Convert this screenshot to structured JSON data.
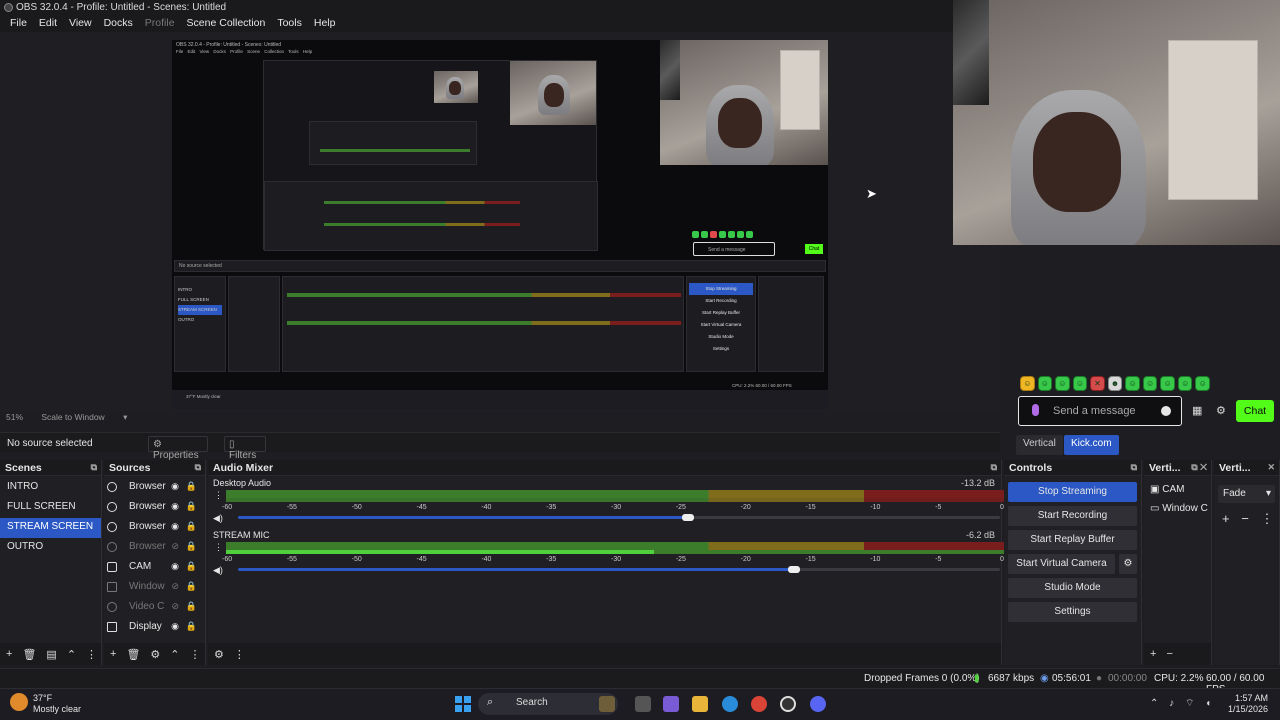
{
  "window": {
    "title": "OBS 32.0.4 - Profile: Untitled - Scenes: Untitled"
  },
  "menu": [
    "File",
    "Edit",
    "View",
    "Docks",
    "Profile",
    "Scene Collection",
    "Tools",
    "Help"
  ],
  "preview": {
    "nested_title": "OBS 32.0.4 - Profile: Untitled - Scenes: Untitled",
    "nested_menu": "File Edit View Docks Profile Scene Collection Tools Help",
    "nested_status": "No source selected",
    "nested_controls": [
      "Stop Streaming",
      "Start Recording",
      "Start Replay Buffer",
      "Start Virtual Camera",
      "Studio Mode",
      "Settings"
    ],
    "nested_scenes": [
      "INTRO",
      "FULL SCREEN",
      "STREAM SCREEN",
      "OUTRO"
    ],
    "nested_cpu": "CPU: 2.2%   60.00 / 60.00 FPS",
    "nested_weather": "37°F Mostly clear"
  },
  "chat": {
    "placeholder": "Send a message",
    "send_label": "Chat",
    "emotes": [
      "☺",
      "☺",
      "☺",
      "☺",
      "✕",
      "☻",
      "☺",
      "☺",
      "☺",
      "☺",
      "☺"
    ]
  },
  "zoom": {
    "level": "51%",
    "mode": "Scale to Window"
  },
  "selection": {
    "status": "No source selected",
    "properties": "Properties",
    "filters": "Filters"
  },
  "tabs": {
    "vertical": "Vertical",
    "kick": "Kick.com"
  },
  "scenes": {
    "title": "Scenes",
    "items": [
      "INTRO",
      "FULL SCREEN",
      "STREAM SCREEN",
      "OUTRO"
    ],
    "selected": "STREAM SCREEN"
  },
  "sources": {
    "title": "Sources",
    "items": [
      {
        "name": "Browser",
        "dim": false
      },
      {
        "name": "Browser",
        "dim": false
      },
      {
        "name": "Browser",
        "dim": false
      },
      {
        "name": "Browser",
        "dim": true
      },
      {
        "name": "CAM",
        "dim": false
      },
      {
        "name": "Window",
        "dim": true
      },
      {
        "name": "Video C",
        "dim": true
      },
      {
        "name": "Display",
        "dim": false
      }
    ]
  },
  "mixer": {
    "title": "Audio Mixer",
    "channels": [
      {
        "name": "Desktop Audio",
        "db": "-13.2 dB",
        "volume": 0.59
      },
      {
        "name": "STREAM MIC",
        "db": "-6.2 dB",
        "volume": 0.73
      }
    ],
    "ticks": [
      "-60",
      "-55",
      "-50",
      "-45",
      "-40",
      "-35",
      "-30",
      "-25",
      "-20",
      "-15",
      "-10",
      "-5",
      "0"
    ]
  },
  "controls": {
    "title": "Controls",
    "buttons": [
      "Stop Streaming",
      "Start Recording",
      "Start Replay Buffer",
      "Start Virtual Camera",
      "Studio Mode",
      "Settings"
    ]
  },
  "vertical_sources": {
    "title": "Verti...",
    "items": [
      "CAM",
      "Window C"
    ]
  },
  "vertical_transitions": {
    "title": "Verti...",
    "transition": "Fade"
  },
  "status": {
    "dropped": "Dropped Frames 0 (0.0%)",
    "bitrate": "6687 kbps",
    "stream_time": "05:56:01",
    "rec_time": "00:00:00",
    "cpu": "CPU: 2.2%",
    "fps": "60.00 / 60.00 FPS"
  },
  "taskbar": {
    "temp": "37°F",
    "weather": "Mostly clear",
    "search": "Search",
    "time": "1:57 AM",
    "date": "1/15/2026"
  },
  "colors": {
    "accent": "#2b58c4",
    "kick_green": "#53fc18"
  }
}
